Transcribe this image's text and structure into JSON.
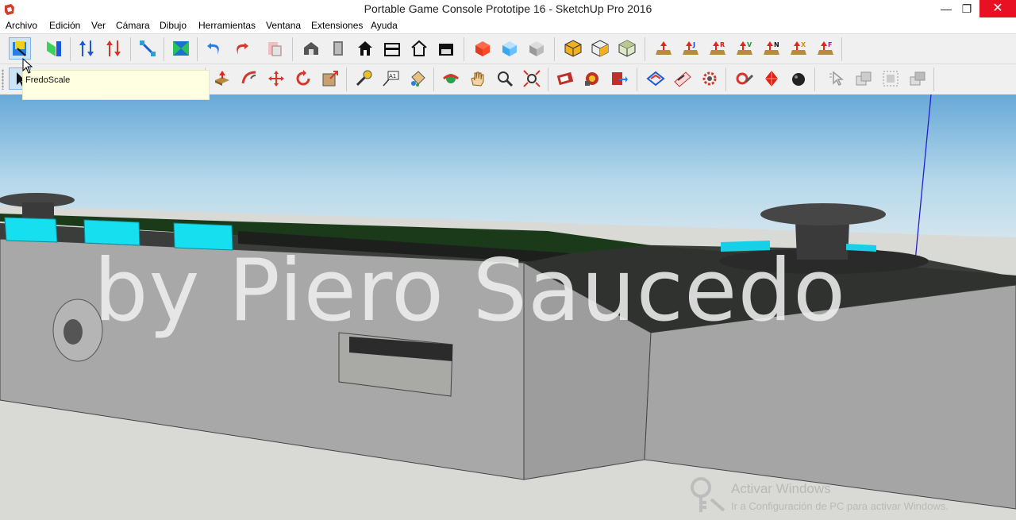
{
  "window": {
    "title": "Portable Game Console Prototipe 16 - SketchUp Pro 2016",
    "minimize_symbol": "—",
    "restore_symbol": "❐",
    "close_symbol": "✕"
  },
  "menu": [
    "Archivo",
    "Edición",
    "Ver",
    "Cámara",
    "Dibujo",
    "Herramientas",
    "Ventana",
    "Extensiones",
    "Ayuda"
  ],
  "tooltip": {
    "text": "FredoScale"
  },
  "toolbar_row1": {
    "icons": [
      "fredoscale-scale-icon",
      "fredoscale-taper-icon",
      "fredoscale-stretch-icon",
      "fredoscale-twist-icon",
      "fredoscale-diagonal-icon",
      "fredoscale-plane-icon",
      "undo-icon",
      "redo-icon",
      "paste-icon",
      "warehouse-icon",
      "door-icon",
      "house-icon",
      "house-outline-icon",
      "building-icon",
      "shed-icon",
      "red-cube-icon",
      "blue-cube-icon",
      "gray-cube-icon",
      "solid-union-icon",
      "solid-subtract-icon",
      "solid-intersect-icon",
      "place-component-icon",
      "place-j-icon",
      "place-r-icon",
      "place-v-icon",
      "place-n-icon",
      "place-x-icon",
      "place-f-icon"
    ]
  },
  "toolbar_row2": {
    "icons": [
      "select-icon",
      "eraser-icon",
      "pencil-icon",
      "arc-icon",
      "circle-icon",
      "push-pull-icon",
      "follow-me-icon",
      "move-icon",
      "rotate-icon",
      "scale-icon",
      "tape-measure-icon",
      "text-icon",
      "paint-bucket-icon",
      "orbit-icon",
      "pan-icon",
      "zoom-icon",
      "zoom-extents-icon",
      "model-info-icon",
      "components-icon",
      "export-icon",
      "section-plane-icon",
      "section-display-icon",
      "settings-gear-icon",
      "ruler-tool-icon",
      "ruby-icon",
      "ball-icon",
      "select-arrow-icon",
      "intersect-faces-icon",
      "group-icon",
      "layers-icon"
    ]
  },
  "viewport": {
    "watermark": "by Piero Saucedo"
  },
  "activation": {
    "line1": "Activar Windows",
    "line2": "Ir a Configuración de PC para activar Windows."
  }
}
